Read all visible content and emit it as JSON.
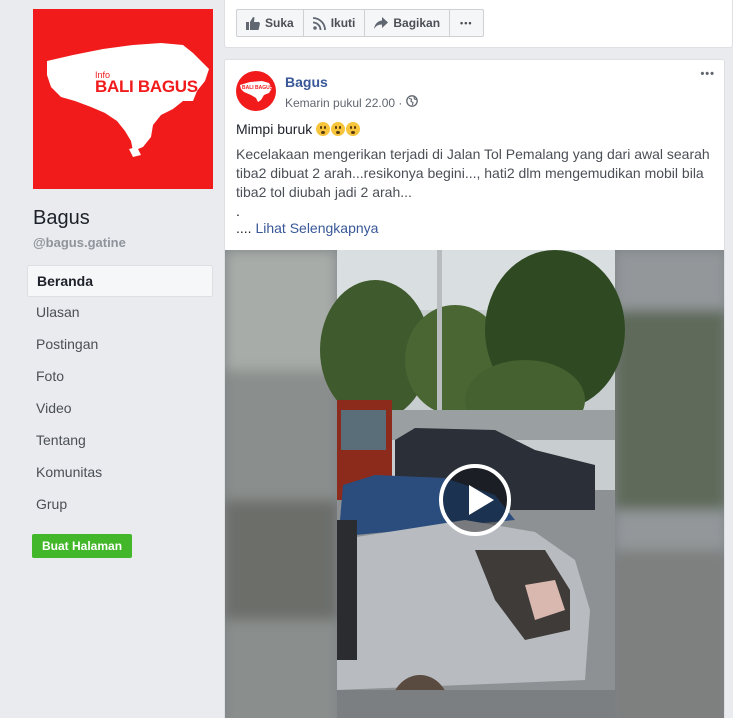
{
  "sidebar": {
    "logo_small": "Info",
    "logo_text": "BALI BAGUS",
    "page_name": "Bagus",
    "page_handle": "@bagus.gatine",
    "nav_items": [
      {
        "label": "Beranda"
      },
      {
        "label": "Ulasan"
      },
      {
        "label": "Postingan"
      },
      {
        "label": "Foto"
      },
      {
        "label": "Video"
      },
      {
        "label": "Tentang"
      },
      {
        "label": "Komunitas"
      },
      {
        "label": "Grup"
      }
    ],
    "create_page_label": "Buat Halaman"
  },
  "action_bar": {
    "like_label": "Suka",
    "follow_label": "Ikuti",
    "share_label": "Bagikan",
    "more_label": "•••"
  },
  "post": {
    "avatar_text": "BALI BAGUS",
    "author": "Bagus",
    "time": "Kemarin pukul 22.00 ·",
    "more_label": "•••",
    "line1": "Mimpi buruk",
    "body": "Kecelakaan mengerikan terjadi di Jalan Tol Pemalang yang dari awal searah tiba2 dibuat 2 arah...resikonya begini..., hati2 dlm mengemudikan mobil bila tiba2 tol diubah jadi 2 arah...",
    "dot_line": ".",
    "ellipsis": "....",
    "see_more": "Lihat Selengkapnya"
  },
  "colors": {
    "brand_red": "#f11b1b",
    "link_blue": "#385898",
    "create_green": "#42b72a"
  },
  "icons": [
    "like-icon",
    "follow-icon",
    "share-icon",
    "globe-icon",
    "play-icon"
  ]
}
